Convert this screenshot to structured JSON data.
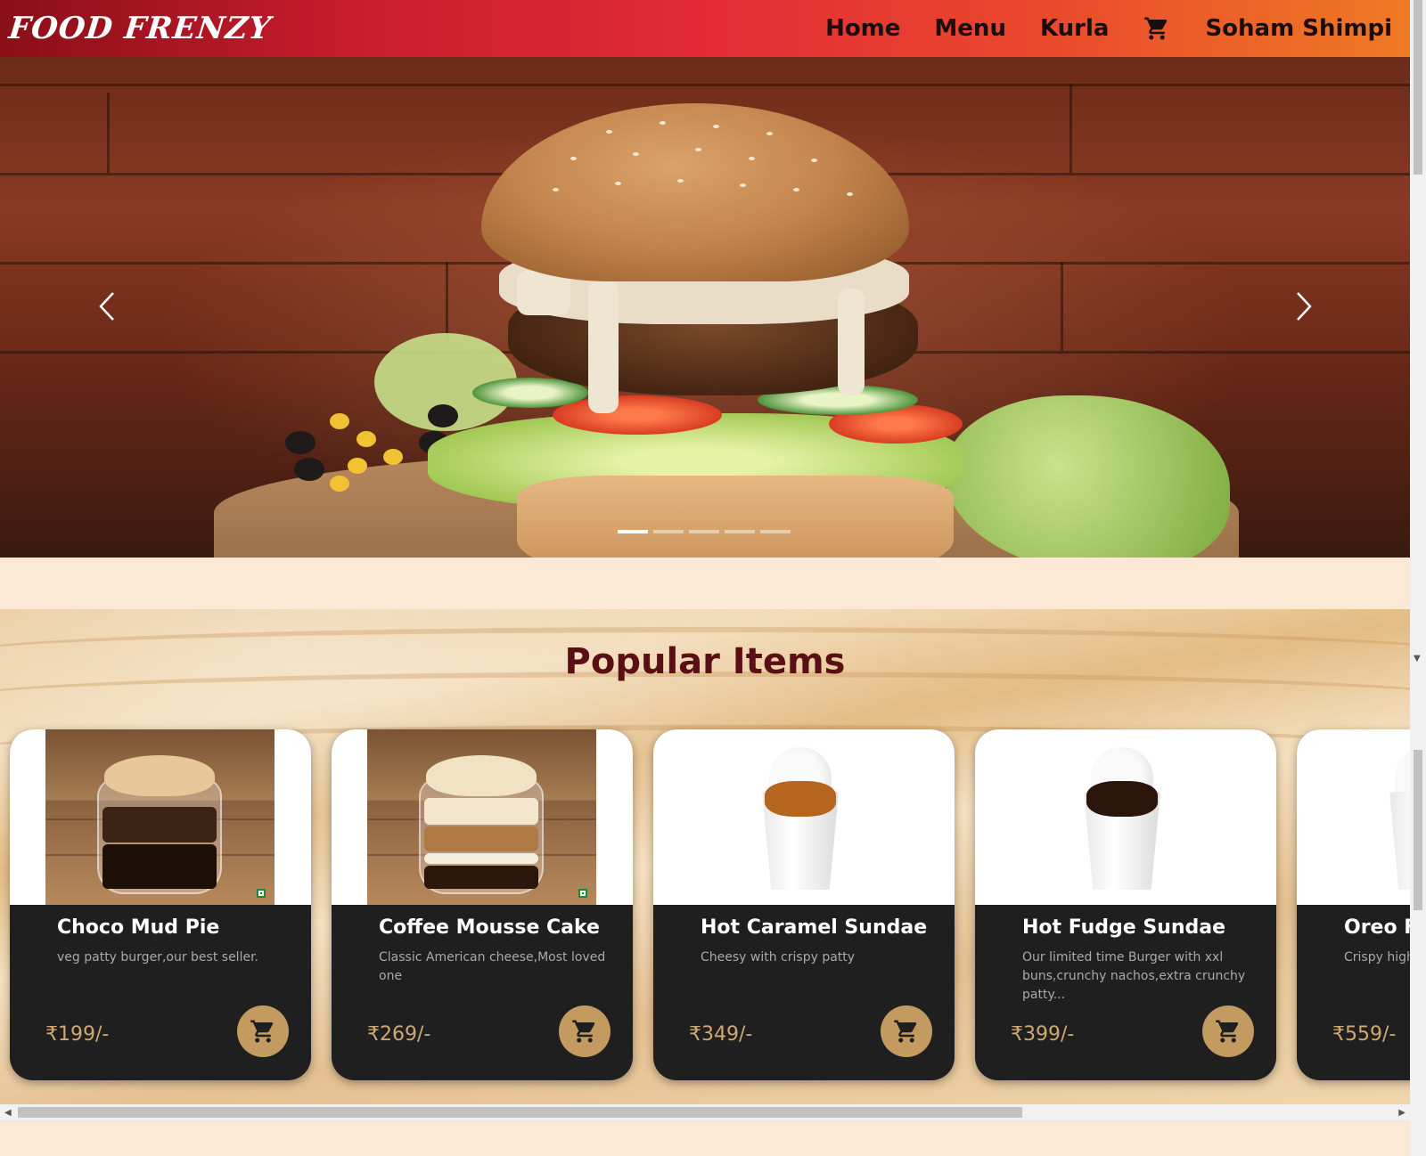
{
  "navbar": {
    "logo": "FOOD FRENZY",
    "links": [
      "Home",
      "Menu",
      "Kurla"
    ],
    "cart_icon": "cart-icon",
    "user_name": "Soham Shimpi"
  },
  "hero": {
    "slide_count": 5,
    "active_slide": 0,
    "prev_icon": "chevron-left-icon",
    "next_icon": "chevron-right-icon"
  },
  "popular": {
    "title": "Popular Items",
    "items": [
      {
        "name": "Choco Mud Pie",
        "description": "veg patty burger,our best seller.",
        "price": "₹199/-",
        "kind": "jar-choco"
      },
      {
        "name": "Coffee Mousse Cake",
        "description": "Classic American cheese,Most loved one",
        "price": "₹269/-",
        "kind": "jar-coffee"
      },
      {
        "name": "Hot Caramel Sundae",
        "description": "Cheesy with crispy patty",
        "price": "₹349/-",
        "kind": "sundae-caramel"
      },
      {
        "name": "Hot Fudge Sundae",
        "description": "Our limited time Burger with xxl buns,crunchy nachos,extra crunchy patty...",
        "price": "₹399/-",
        "kind": "sundae-fudge"
      },
      {
        "name": "Oreo Flu",
        "description": "Crispy high i Overloaded.",
        "price": "₹559/-",
        "kind": "sundae-oreo"
      }
    ]
  },
  "colors": {
    "accent_gold": "#c39a5f",
    "title_maroon": "#5a0f14",
    "card_bg": "#1f1f1f"
  }
}
